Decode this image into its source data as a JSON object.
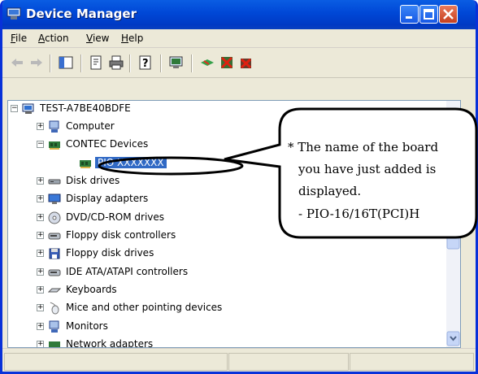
{
  "window": {
    "title": "Device Manager"
  },
  "menu": [
    {
      "label": "File",
      "mn": "F",
      "rest": "ile"
    },
    {
      "label": "Action",
      "mn": "A",
      "rest": "ction"
    },
    {
      "label": "View",
      "mn": "V",
      "rest": "iew"
    },
    {
      "label": "Help",
      "mn": "H",
      "rest": "elp"
    }
  ],
  "toolbar": {
    "icons": [
      "back-arrow-icon",
      "forward-arrow-icon",
      "show-hide-tree-icon",
      "properties-icon",
      "print-icon",
      "help-icon",
      "scan-hardware-icon",
      "update-driver-icon",
      "disable-device-icon",
      "uninstall-device-icon"
    ]
  },
  "tree": {
    "root": "TEST-A7BE40BDFE",
    "items": [
      {
        "label": "Computer",
        "icon": "computer-icon"
      },
      {
        "label": "CONTEC Devices",
        "icon": "board-icon",
        "expanded": true
      },
      {
        "label": "PIO  XXXXXXX",
        "icon": "board-icon",
        "child": true,
        "selected": true
      },
      {
        "label": "Disk drives",
        "icon": "disk-icon"
      },
      {
        "label": "Display adapters",
        "icon": "display-icon"
      },
      {
        "label": "DVD/CD-ROM drives",
        "icon": "cdrom-icon"
      },
      {
        "label": "Floppy disk controllers",
        "icon": "controller-icon"
      },
      {
        "label": "Floppy disk drives",
        "icon": "floppy-icon"
      },
      {
        "label": "IDE ATA/ATAPI controllers",
        "icon": "controller-icon"
      },
      {
        "label": "Keyboards",
        "icon": "keyboard-icon"
      },
      {
        "label": "Mice and other pointing devices",
        "icon": "mouse-icon"
      },
      {
        "label": "Monitors",
        "icon": "monitor-icon"
      },
      {
        "label": "Network adapters",
        "icon": "network-icon"
      }
    ]
  },
  "callout": {
    "lines": [
      "* The name of the board",
      "you have just added is",
      "displayed.",
      "- PIO-16/16T(PCI)H"
    ]
  },
  "colors": {
    "titlebar": "#0047d6",
    "selection": "#316ac5",
    "callout_border": "#000000"
  }
}
